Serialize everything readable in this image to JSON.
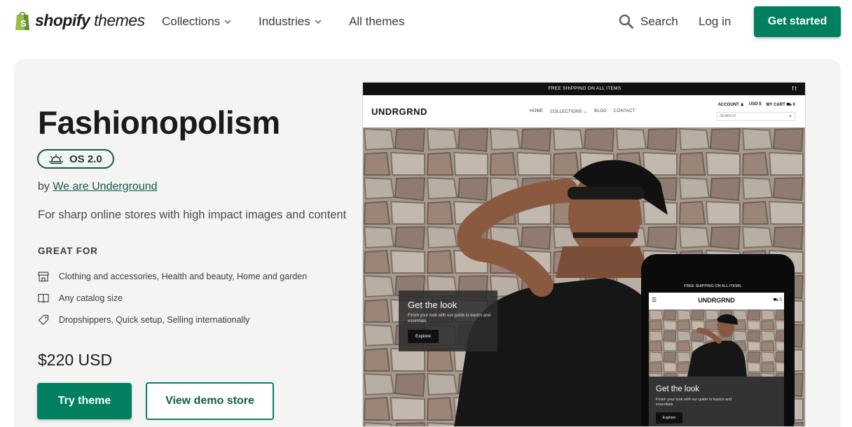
{
  "brand": {
    "bold": "shopify",
    "light": "themes"
  },
  "nav": {
    "collections": "Collections",
    "industries": "Industries",
    "all_themes": "All themes",
    "search": "Search",
    "login": "Log in",
    "get_started": "Get started"
  },
  "theme": {
    "name": "Fashionopolism",
    "badge": "OS 2.0",
    "by_prefix": "by",
    "author": "We are Underground",
    "tagline": "For sharp online stores with high impact images and content",
    "great_for_heading": "GREAT FOR",
    "features": [
      {
        "icon": "store-icon",
        "text": "Clothing and accessories, Health and beauty, Home and garden"
      },
      {
        "icon": "catalog-icon",
        "text": "Any catalog size"
      },
      {
        "icon": "tag-icon",
        "text": "Dropshippers, Quick setup, Selling internationally"
      }
    ],
    "price": "$220 USD",
    "try_label": "Try theme",
    "demo_label": "View demo store"
  },
  "preview": {
    "shipping": "FREE SHIPPING ON ALL ITEMS",
    "social": "f   t",
    "store_logo": "UNDRGRND",
    "menu": [
      "HOME",
      "COLLECTIONS",
      "BLOG",
      "CONTACT"
    ],
    "account": "ACCOUNT",
    "currency": "USD $",
    "cart": "MY CART",
    "cart_count": "0",
    "search_placeholder": "SEARCH",
    "look_title": "Get the look",
    "look_sub": "Finish your look with our guide to basics and essentials",
    "explore": "Explore",
    "colors": {
      "accent": "#008060",
      "panel": "#f4f4f2"
    }
  }
}
